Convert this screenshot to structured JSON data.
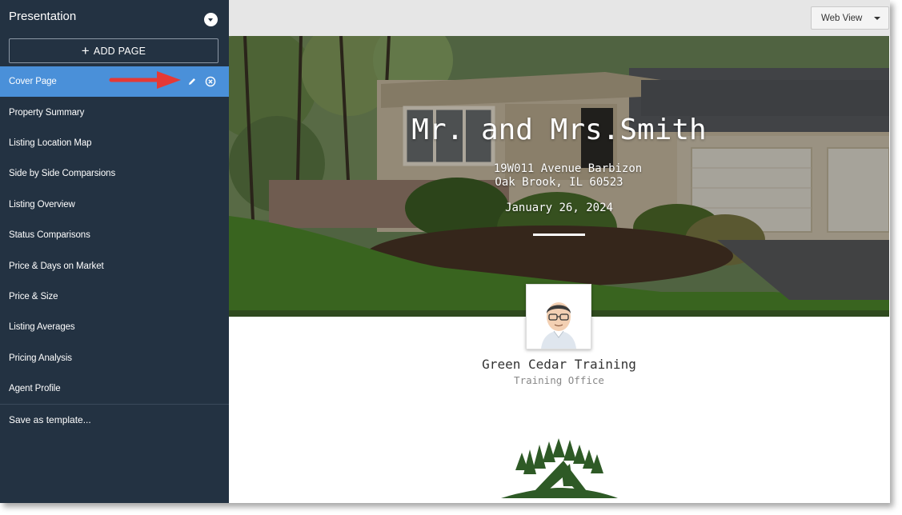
{
  "sidebar": {
    "title": "Presentation",
    "add_page_label": "ADD PAGE",
    "items": [
      {
        "label": "Cover Page",
        "active": true
      },
      {
        "label": "Property Summary"
      },
      {
        "label": "Listing Location Map"
      },
      {
        "label": "Side by Side Comparsions"
      },
      {
        "label": "Listing Overview"
      },
      {
        "label": "Status Comparisons"
      },
      {
        "label": "Price & Days on Market"
      },
      {
        "label": "Price & Size"
      },
      {
        "label": "Listing Averages"
      },
      {
        "label": "Pricing Analysis"
      },
      {
        "label": "Agent Profile"
      }
    ],
    "save_template_label": "Save as template...",
    "icons": {
      "toggle": "chevron-down-circle-icon",
      "add": "plus-icon",
      "edit": "pencil-icon",
      "remove": "close-circle-icon"
    }
  },
  "toolbar": {
    "view_select": "Web View"
  },
  "cover": {
    "client_name": "Mr. and Mrs.Smith",
    "address_line1": "19W011 Avenue Barbizon",
    "address_line2": "Oak Brook, IL 60523",
    "date": "January 26, 2024"
  },
  "agent": {
    "name": "Green Cedar Training",
    "office": "Training Office"
  },
  "colors": {
    "sidebar_bg": "#233242",
    "active_item": "#4a90d9",
    "annotation_arrow": "#e53935",
    "logo_green": "#2e5a26"
  }
}
